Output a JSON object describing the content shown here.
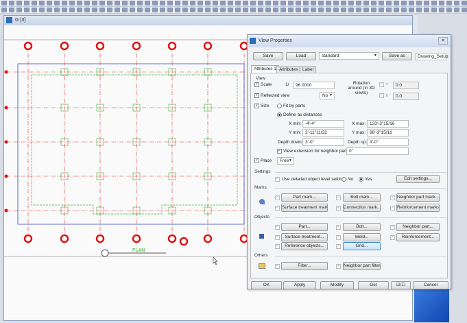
{
  "window": {
    "title": "G [3]"
  },
  "drawing": {
    "view_label": "PLAN",
    "colors": {
      "grid_bubble": "#e01010",
      "outline": "#3040c0",
      "parts": "#30b030",
      "gridline": "#e03030"
    }
  },
  "dialog": {
    "title": "View Properties",
    "save": "Save",
    "load": "Load",
    "preset": "standard",
    "save_as": "Save as",
    "save_as_name": "Drawing_Setup",
    "tabs": [
      "Attributes 1",
      "Attributes 2",
      "Label"
    ],
    "view_group": "View",
    "scale_label": "Scale",
    "scale_prefix": "1/",
    "scale_value": "96.0000",
    "rotation_label": "Rotation around (in 3D views)",
    "rot_y_label": "Y",
    "rot_y": "0.0",
    "rot_x_label": "X",
    "rot_x": "0.0",
    "reflected_label": "Reflected view",
    "reflected_value": "No",
    "size_label": "Size",
    "fit_by_parts": "Fit by parts",
    "define_distances": "Define as distances",
    "xmin_label": "X min:",
    "xmin": "-4'-4\"",
    "xmax_label": "X max:",
    "xmax": "133'-3\"15/16",
    "ymin_label": "Y min:",
    "ymin": "3'-11\"11/32",
    "ymax_label": "Y max:",
    "ymax": "88'-3\"15/16",
    "depth_down_label": "Depth down:",
    "depth_down": "3'-0\"",
    "depth_up_label": "Depth up:",
    "depth_up": "3'-0\"",
    "view_ext_label": "View extension for neighbor parts:",
    "view_ext": "0\"",
    "place_label": "Place",
    "place_value": "Free",
    "settings_group": "Settings",
    "use_detailed": "Use detailed object level settings",
    "no": "No",
    "yes": "Yes",
    "edit_settings": "Edit settings...",
    "marks_group": "Marks",
    "marks": [
      "Part mark...",
      "Bolt mark...",
      "Neighbor part mark...",
      "Surface treatment mark...",
      "Connection mark...",
      "Reinforcement marks..."
    ],
    "objects_group": "Objects",
    "objects": [
      "Part...",
      "Bolt...",
      "Neighbor part...",
      "Surface treatment...",
      "Weld...",
      "Reinforcement...",
      "Reference objects...",
      "Grid..."
    ],
    "others_group": "Others",
    "filter": "Filter...",
    "neighbor_filter": "Neighbor part filter...",
    "ok": "OK",
    "apply": "Apply",
    "modify": "Modify",
    "get": "Get",
    "toggle": "☑/☐",
    "cancel": "Cancel"
  }
}
